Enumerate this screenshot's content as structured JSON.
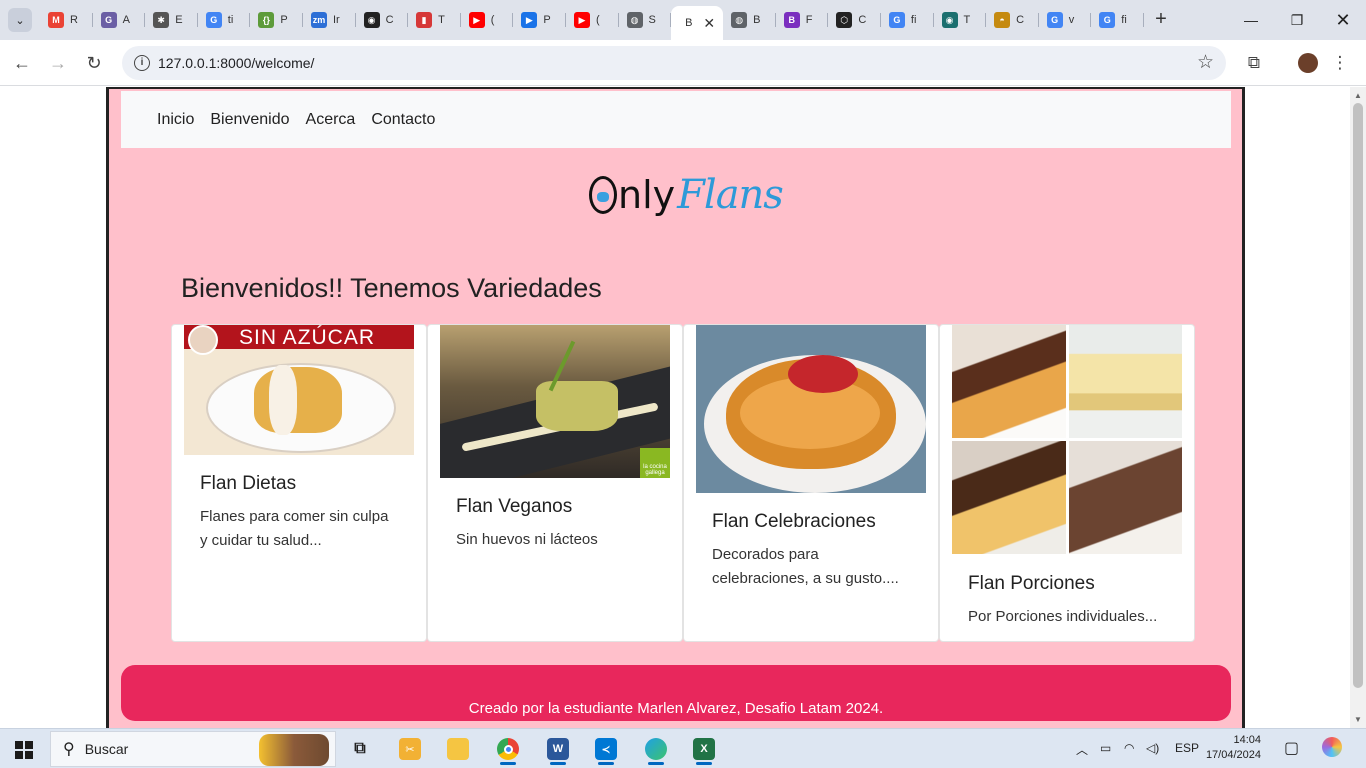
{
  "browser": {
    "tabs": [
      {
        "fav": "M",
        "title": "R",
        "color": "#ea4335"
      },
      {
        "fav": "G",
        "title": "A",
        "color": "#6b5fa5"
      },
      {
        "fav": "✱",
        "title": "E",
        "color": "#555555"
      },
      {
        "fav": "G",
        "title": "ti",
        "color": "#4285f4"
      },
      {
        "fav": "{}",
        "title": "P",
        "color": "#5d9b3a"
      },
      {
        "fav": "zm",
        "title": "Ir",
        "color": "#2d6fd6"
      },
      {
        "fav": "◉",
        "title": "C",
        "color": "#222222"
      },
      {
        "fav": "▮",
        "title": "T",
        "color": "#d63838"
      },
      {
        "fav": "▶",
        "title": "(",
        "color": "#ff0000"
      },
      {
        "fav": "▶",
        "title": "P",
        "color": "#1a73e8"
      },
      {
        "fav": "▶",
        "title": "(",
        "color": "#ff0000"
      },
      {
        "fav": "◍",
        "title": "S",
        "color": "#5f6368"
      },
      {
        "fav": "",
        "title": "B",
        "color": "#ffffff",
        "active": true
      },
      {
        "fav": "◍",
        "title": "B",
        "color": "#5f6368"
      },
      {
        "fav": "B",
        "title": "F",
        "color": "#7b2fbf"
      },
      {
        "fav": "⬡",
        "title": "C",
        "color": "#222222"
      },
      {
        "fav": "G",
        "title": "fi",
        "color": "#4285f4"
      },
      {
        "fav": "◉",
        "title": "T",
        "color": "#1b6f6f"
      },
      {
        "fav": "◓",
        "title": "C",
        "color": "#c58a10"
      },
      {
        "fav": "G",
        "title": "v",
        "color": "#4285f4"
      },
      {
        "fav": "G",
        "title": "fi",
        "color": "#4285f4"
      }
    ],
    "url": "127.0.0.1:8000/welcome/",
    "tab_close": "✕",
    "new_tab": "+"
  },
  "site": {
    "nav": [
      "Inicio",
      "Bienvenido",
      "Acerca",
      "Contacto"
    ],
    "logo": {
      "part1": "nly",
      "part2": "Flans"
    },
    "heading": "Bienvenidos!! Tenemos Variedades",
    "cards": [
      {
        "title": "Flan Dietas",
        "text": "Flanes para comer sin culpa y cuidar tu salud...",
        "image_banner": "SIN AZÚCAR"
      },
      {
        "title": "Flan Veganos",
        "text": "Sin huevos ni lácteos",
        "image_badge": "la cocina gallega"
      },
      {
        "title": "Flan Celebraciones",
        "text": "Decorados para celebraciones, a su gusto...."
      },
      {
        "title": "Flan Porciones",
        "text": "Por Porciones individuales..."
      }
    ],
    "footer": "Creado por la estudiante Marlen Alvarez, Desafio Latam 2024.",
    "colors": {
      "background": "#ffc0cb",
      "footer": "#e8275c",
      "logo_accent": "#2d9ad8"
    }
  },
  "taskbar": {
    "search_placeholder": "Buscar",
    "apps": [
      "task-view",
      "snip",
      "file-explorer",
      "chrome",
      "word",
      "vscode",
      "edge",
      "excel"
    ],
    "language": "ESP",
    "time": "14:04",
    "date": "17/04/2024"
  }
}
